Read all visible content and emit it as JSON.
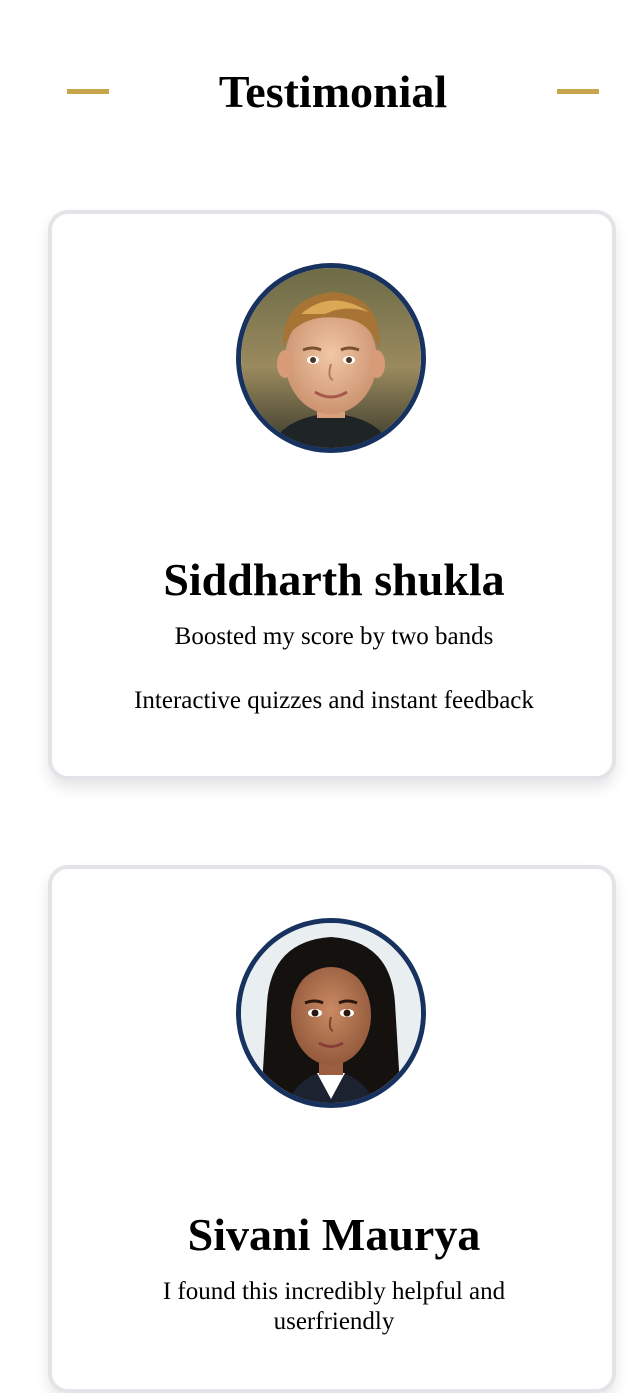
{
  "section": {
    "title": "Testimonial",
    "accent_color": "#c8a44c"
  },
  "testimonials": [
    {
      "avatar_icon": "boy-portrait-icon",
      "name": "Siddharth shukla",
      "line1": "Boosted my score by two bands",
      "line2": "Interactive quizzes and instant feedback"
    },
    {
      "avatar_icon": "girl-portrait-icon",
      "name": "Sivani Maurya",
      "line1": "I found this incredibly helpful and userfriendly"
    }
  ],
  "colors": {
    "avatar_border": "#17325f",
    "card_border": "#e4e3e8"
  }
}
